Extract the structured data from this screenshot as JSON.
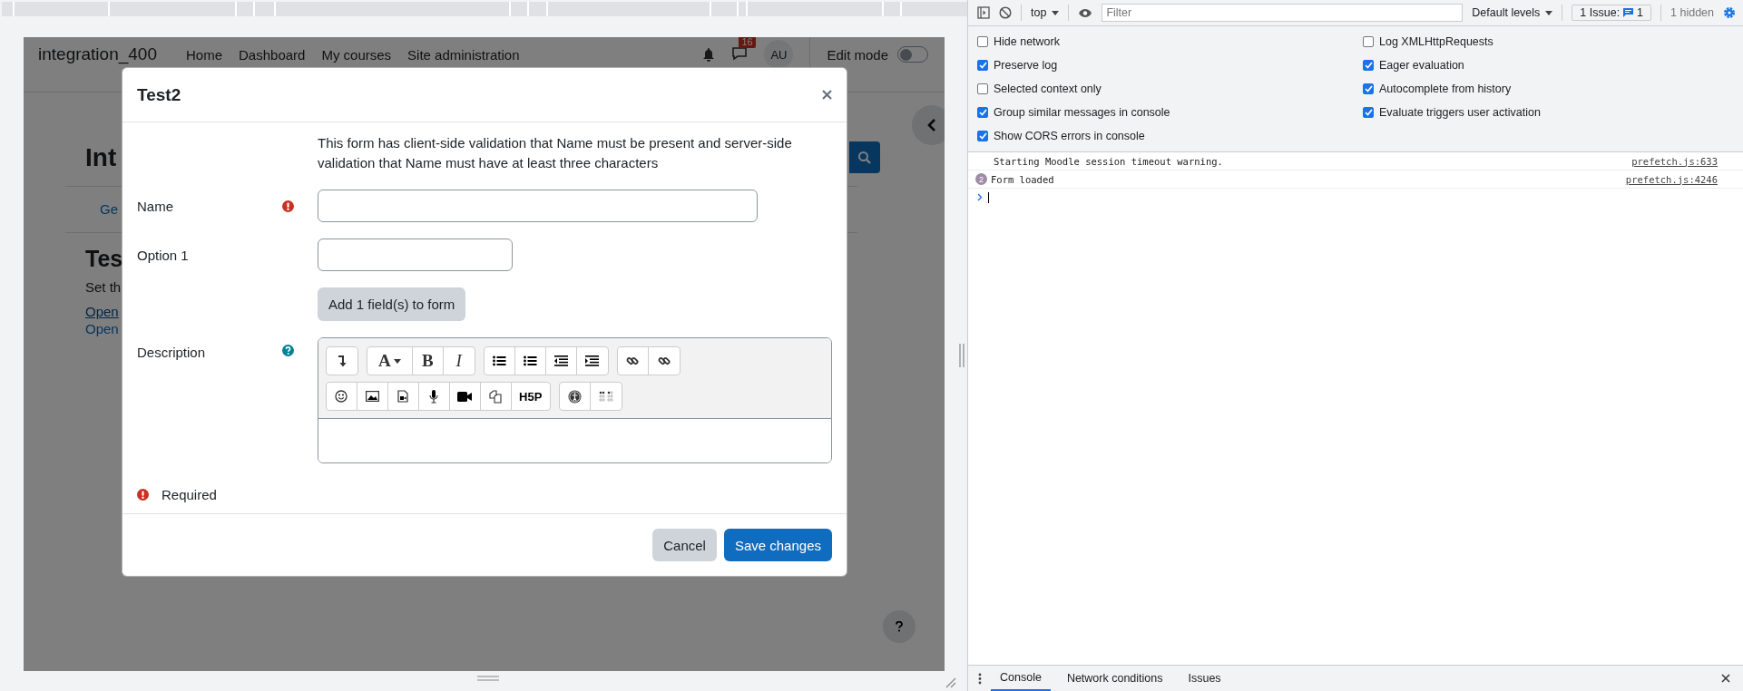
{
  "page": {
    "site_name": "integration_400",
    "nav": [
      "Home",
      "Dashboard",
      "My courses",
      "Site administration"
    ],
    "notification_count": "16",
    "avatar": "AU",
    "edit_mode": {
      "label": "Edit mode",
      "on": false
    },
    "heading": "Int",
    "tabs": [
      "Ge"
    ],
    "section_heading": "Tes",
    "text": "Set th",
    "links": [
      "Open",
      "Open"
    ]
  },
  "modal": {
    "title": "Test2",
    "intro": "This form has client-side validation that Name must be present and server-side validation that Name must have at least three characters",
    "fields": [
      {
        "kind": "text",
        "label": "Name",
        "required": true
      },
      {
        "kind": "short-text",
        "label": "Option 1",
        "required": false
      },
      {
        "kind": "button",
        "label": "Add 1 field(s) to form"
      },
      {
        "kind": "editor",
        "label": "Description",
        "help": true
      }
    ],
    "toolbar": [
      [
        [
          {
            "kind": "collapse"
          }
        ],
        [
          {
            "kind": "font",
            "label": "A"
          },
          {
            "kind": "bold",
            "label": "B"
          },
          {
            "kind": "italic",
            "label": "I"
          }
        ],
        [
          {
            "kind": "bullets"
          },
          {
            "kind": "numbers"
          },
          {
            "kind": "outdent"
          },
          {
            "kind": "indent"
          }
        ],
        [
          {
            "kind": "link"
          },
          {
            "kind": "unlink"
          }
        ]
      ],
      [
        [
          {
            "kind": "emoji"
          },
          {
            "kind": "image"
          },
          {
            "kind": "media"
          },
          {
            "kind": "microphone"
          },
          {
            "kind": "video"
          },
          {
            "kind": "copy"
          },
          {
            "kind": "logo",
            "label": "H5P"
          }
        ],
        [
          {
            "kind": "accessibility"
          },
          {
            "kind": "braille"
          }
        ]
      ]
    ],
    "required_note": "Required",
    "buttons": [
      {
        "label": "Cancel",
        "kind": "secondary"
      },
      {
        "label": "Save changes",
        "kind": "primary"
      }
    ]
  },
  "devtools": {
    "context": "top",
    "filter_placeholder": "Filter",
    "levels": "Default levels",
    "issues": {
      "label": "1 Issue:",
      "count": "1"
    },
    "hidden": "1 hidden",
    "settings": [
      {
        "label": "Hide network",
        "checked": false
      },
      {
        "label": "Log XMLHttpRequests",
        "checked": false
      },
      {
        "label": "Preserve log",
        "checked": true
      },
      {
        "label": "Eager evaluation",
        "checked": true
      },
      {
        "label": "Selected context only",
        "checked": false
      },
      {
        "label": "Autocomplete from history",
        "checked": true
      },
      {
        "label": "Group similar messages in console",
        "checked": true
      },
      {
        "label": "Evaluate triggers user activation",
        "checked": true
      },
      {
        "label": "Show CORS errors in console",
        "checked": true
      }
    ],
    "messages": [
      {
        "text": "Starting Moodle session timeout warning.",
        "source": "prefetch.js:633"
      },
      {
        "text": "Form loaded",
        "source": "prefetch.js:4246",
        "repeat": "2"
      }
    ],
    "tabs": [
      {
        "label": "Console",
        "selected": true
      },
      {
        "label": "Network conditions",
        "selected": false
      },
      {
        "label": "Issues",
        "selected": false
      }
    ]
  }
}
